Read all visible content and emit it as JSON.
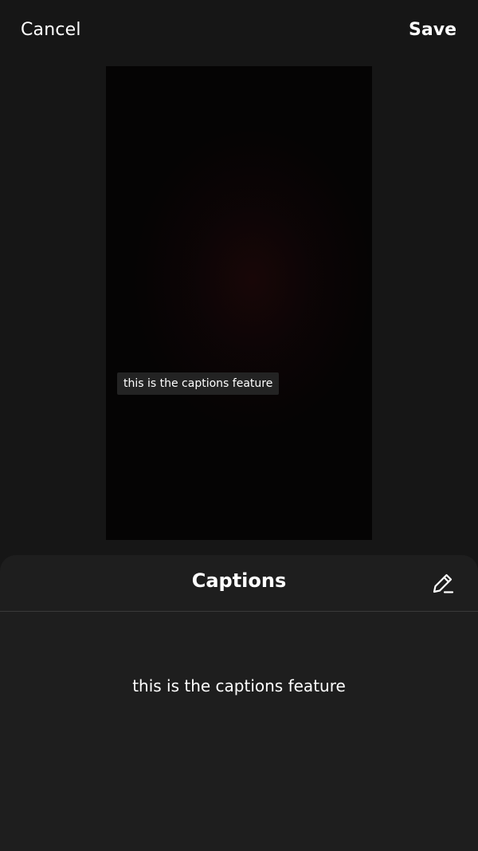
{
  "header": {
    "cancel_label": "Cancel",
    "save_label": "Save"
  },
  "preview": {
    "caption_overlay": "this is the captions feature"
  },
  "sheet": {
    "title": "Captions",
    "edit_icon": "pencil-edit-icon",
    "caption_text": "this is the captions feature"
  },
  "colors": {
    "background": "#161616",
    "sheet": "#1e1e1e",
    "divider": "#3a3a3a",
    "text": "#ffffff",
    "caption_bg": "#232323"
  }
}
